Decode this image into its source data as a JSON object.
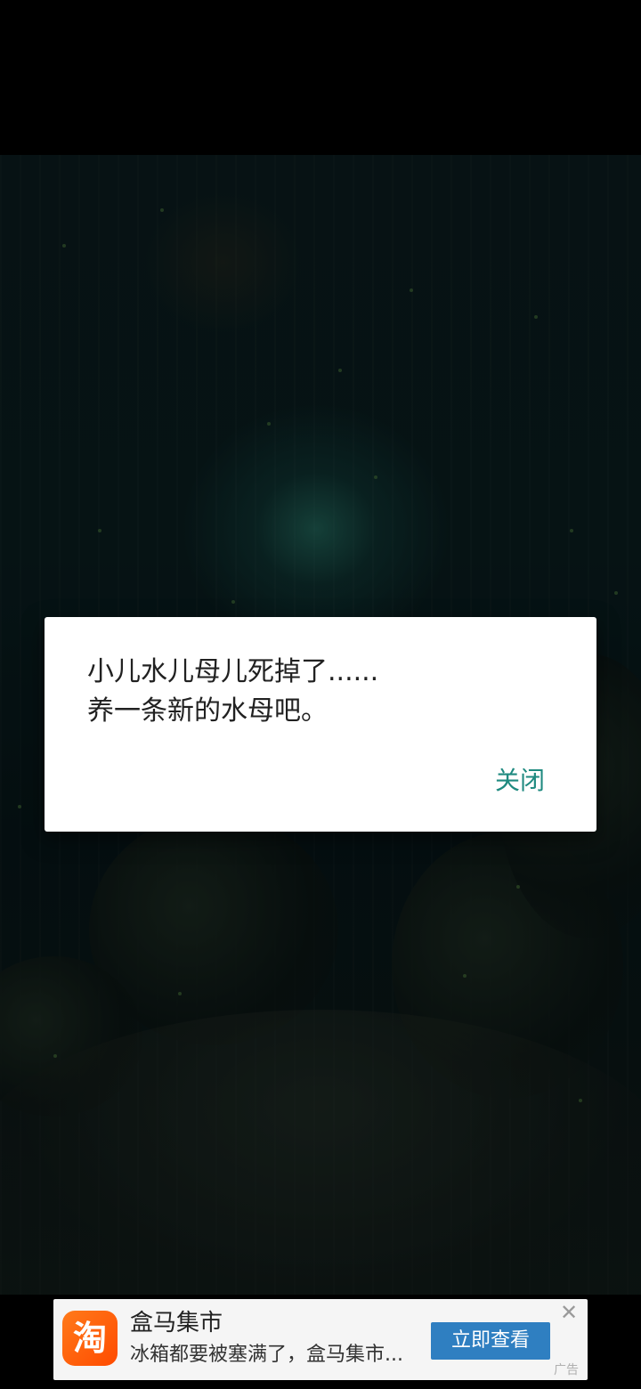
{
  "dialog": {
    "message": "小儿水儿母儿死掉了......\n养一条新的水母吧。",
    "close_label": "关闭"
  },
  "ad": {
    "logo_char": "淘",
    "title": "盒马集市",
    "description": "冰箱都要被塞满了，盒马集市...",
    "cta_label": "立即查看",
    "close_symbol": "✕",
    "tag": "广告"
  }
}
